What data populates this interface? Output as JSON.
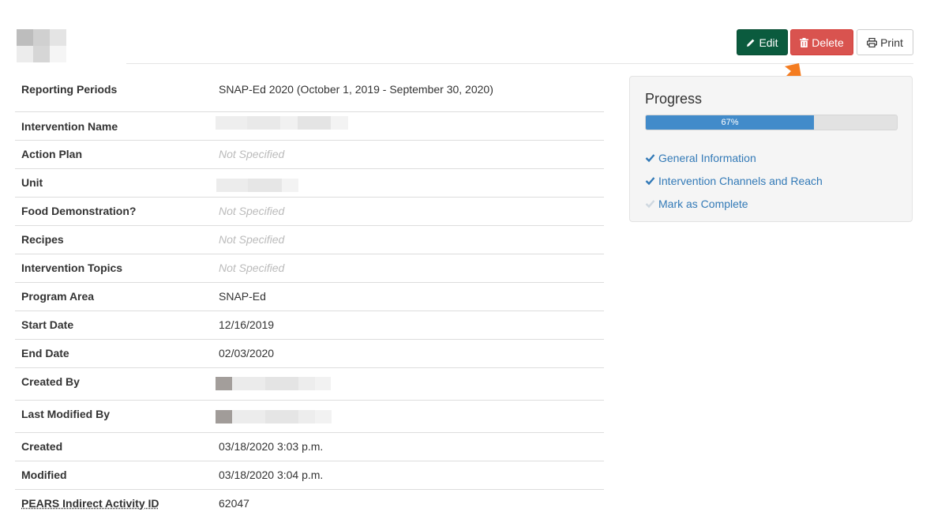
{
  "toolbar": {
    "edit_label": "Edit",
    "delete_label": "Delete",
    "print_label": "Print"
  },
  "details": {
    "rows": [
      {
        "label": "Reporting Periods",
        "value": "SNAP-Ed 2020 (October 1, 2019 - September 30, 2020)"
      },
      {
        "label": "Intervention Name",
        "value": ""
      },
      {
        "label": "Action Plan",
        "value": "Not Specified"
      },
      {
        "label": "Unit",
        "value": ""
      },
      {
        "label": "Food Demonstration?",
        "value": "Not Specified"
      },
      {
        "label": "Recipes",
        "value": "Not Specified"
      },
      {
        "label": "Intervention Topics",
        "value": "Not Specified"
      },
      {
        "label": "Program Area",
        "value": "SNAP-Ed"
      },
      {
        "label": "Start Date",
        "value": "12/16/2019"
      },
      {
        "label": "End Date",
        "value": "02/03/2020"
      },
      {
        "label": "Created By",
        "value": ""
      },
      {
        "label": "Last Modified By",
        "value": ""
      },
      {
        "label": "Created",
        "value": "03/18/2020 3:03 p.m."
      },
      {
        "label": "Modified",
        "value": "03/18/2020 3:04 p.m."
      },
      {
        "label": "PEARS Indirect Activity ID",
        "value": "62047"
      }
    ]
  },
  "progress": {
    "title": "Progress",
    "percent_label": "67%",
    "fraction": 0.67,
    "steps": [
      {
        "label": "General Information",
        "complete": true
      },
      {
        "label": "Intervention Channels and Reach",
        "complete": true
      },
      {
        "label": "Mark as Complete",
        "complete": false
      }
    ]
  },
  "colors": {
    "edit": "#0b5b3e",
    "delete": "#d9534f",
    "progress_fill": "#428bca",
    "link": "#337ab7",
    "annotation_arrow": "#f47c20"
  },
  "icons": {
    "edit": "pencil-icon",
    "delete": "trash-icon",
    "print": "printer-icon",
    "step_done": "check-icon"
  }
}
